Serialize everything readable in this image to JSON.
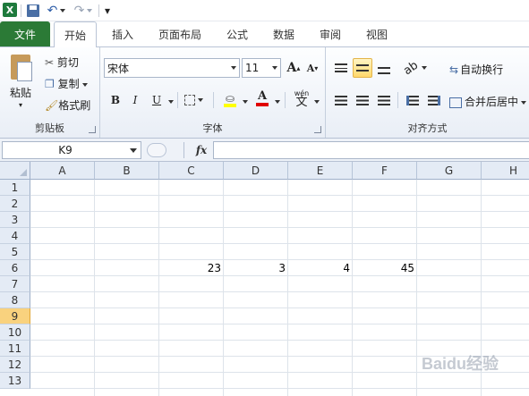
{
  "qat": {
    "dropdown_glyph": "▾"
  },
  "tabs": [
    "文件",
    "开始",
    "插入",
    "页面布局",
    "公式",
    "数据",
    "审阅",
    "视图"
  ],
  "clipboard": {
    "paste": "粘贴",
    "cut": "剪切",
    "copy": "复制",
    "format_painter": "格式刷",
    "label": "剪贴板"
  },
  "font": {
    "name": "宋体",
    "size": "11",
    "bold": "B",
    "italic": "I",
    "underline": "U",
    "label": "字体",
    "grow": "A",
    "shrink": "A",
    "phonetic": "wén",
    "phonetic_char": "文"
  },
  "alignment": {
    "wrap_text": "自动换行",
    "merge_center": "合并后居中",
    "label": "对齐方式"
  },
  "formula_bar": {
    "name_box": "K9",
    "fx": "fx",
    "formula": ""
  },
  "columns": [
    "A",
    "B",
    "C",
    "D",
    "E",
    "F",
    "G",
    "H"
  ],
  "rows": [
    "1",
    "2",
    "3",
    "4",
    "5",
    "6",
    "7",
    "8",
    "9",
    "10",
    "11",
    "12",
    "13"
  ],
  "selected_row": "9",
  "cells": {
    "C6": "23",
    "D6": "3",
    "E6": "4",
    "F6": "45"
  },
  "watermark": "Baidu经验",
  "colors": {
    "file_tab": "#2b7a36",
    "selected_header": "#f9d27e",
    "ribbon_bg": "#e9eef6"
  }
}
